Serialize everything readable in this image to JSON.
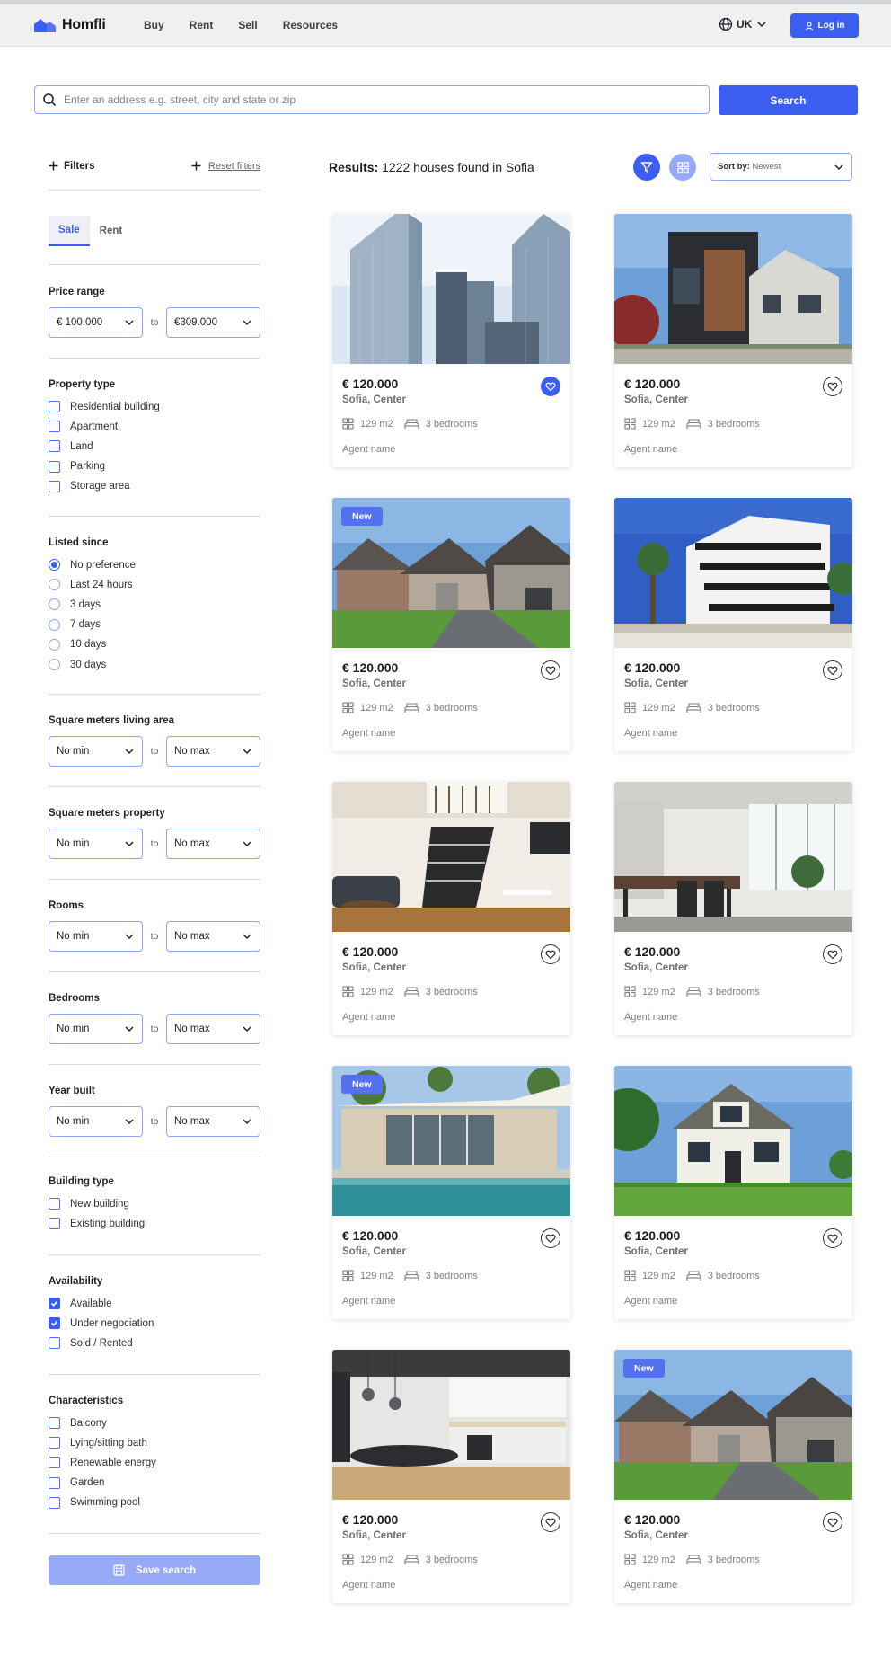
{
  "app": {
    "name": "Homfli"
  },
  "nav": [
    "Buy",
    "Rent",
    "Sell",
    "Resources"
  ],
  "header": {
    "language": "UK",
    "login_label": "Log in"
  },
  "search": {
    "placeholder": "Enter an address e.g. street, city and state or zip",
    "button_label": "Search"
  },
  "sidebar": {
    "filters_label": "Filters",
    "reset_label": "Reset filters",
    "tabs": [
      {
        "label": "Sale",
        "active": true
      },
      {
        "label": "Rent",
        "active": false
      }
    ],
    "price_range": {
      "title": "Price range",
      "from": "€ 100.000",
      "to": "€309.000",
      "to_label": "to"
    },
    "property_type": {
      "title": "Property type",
      "options": [
        "Residential building",
        "Apartment",
        "Land",
        "Parking",
        "Storage area"
      ]
    },
    "listed_since": {
      "title": "Listed since",
      "options": [
        "No preference",
        "Last 24 hours",
        "3 days",
        "7 days",
        "10 days",
        "30 days"
      ],
      "selected": "No preference"
    },
    "ranges": [
      {
        "title": "Square meters living area",
        "min": "No min",
        "max": "No max"
      },
      {
        "title": "Square meters property",
        "min": "No min",
        "max": "No max"
      },
      {
        "title": "Rooms",
        "min": "No min",
        "max": "No max"
      },
      {
        "title": "Bedrooms",
        "min": "No min",
        "max": "No max"
      },
      {
        "title": "Year built",
        "min": "No min",
        "max": "No max"
      }
    ],
    "building_type": {
      "title": "Building type",
      "options": [
        "New building",
        "Existing building"
      ]
    },
    "availability": {
      "title": "Availability",
      "options": [
        {
          "label": "Available",
          "checked": true
        },
        {
          "label": "Under negociation",
          "checked": true
        },
        {
          "label": "Sold / Rented",
          "checked": false
        }
      ]
    },
    "characteristics": {
      "title": "Characteristics",
      "options": [
        "Balcony",
        "Lying/sitting bath",
        "Renewable energy",
        "Garden",
        "Swimming pool"
      ]
    },
    "save_label": "Save search"
  },
  "results": {
    "label": "Results:",
    "text": "1222 houses found in Sofia",
    "sort_label": "Sort by:",
    "sort_value": "Newest"
  },
  "listings": [
    {
      "price": "€ 120.000",
      "location": "Sofia, Center",
      "area": "129 m2",
      "bedrooms": "3 bedrooms",
      "agent": "Agent name",
      "badge": "",
      "favorite": true,
      "image": "skyscrapers"
    },
    {
      "price": "€ 120.000",
      "location": "Sofia, Center",
      "area": "129 m2",
      "bedrooms": "3 bedrooms",
      "agent": "Agent name",
      "badge": "",
      "favorite": false,
      "image": "modern-house"
    },
    {
      "price": "€ 120.000",
      "location": "Sofia, Center",
      "area": "129 m2",
      "bedrooms": "3 bedrooms",
      "agent": "Agent name",
      "badge": "New",
      "favorite": false,
      "image": "suburban-houses"
    },
    {
      "price": "€ 120.000",
      "location": "Sofia, Center",
      "area": "129 m2",
      "bedrooms": "3 bedrooms",
      "agent": "Agent name",
      "badge": "",
      "favorite": false,
      "image": "white-apartment"
    },
    {
      "price": "€ 120.000",
      "location": "Sofia, Center",
      "area": "129 m2",
      "bedrooms": "3 bedrooms",
      "agent": "Agent name",
      "badge": "",
      "favorite": false,
      "image": "living-room"
    },
    {
      "price": "€ 120.000",
      "location": "Sofia, Center",
      "area": "129 m2",
      "bedrooms": "3 bedrooms",
      "agent": "Agent name",
      "badge": "",
      "favorite": false,
      "image": "kitchen-dining"
    },
    {
      "price": "€ 120.000",
      "location": "Sofia, Center",
      "area": "129 m2",
      "bedrooms": "3 bedrooms",
      "agent": "Agent name",
      "badge": "New",
      "favorite": false,
      "image": "pool-house"
    },
    {
      "price": "€ 120.000",
      "location": "Sofia, Center",
      "area": "129 m2",
      "bedrooms": "3 bedrooms",
      "agent": "Agent name",
      "badge": "",
      "favorite": false,
      "image": "cottage"
    },
    {
      "price": "€ 120.000",
      "location": "Sofia, Center",
      "area": "129 m2",
      "bedrooms": "3 bedrooms",
      "agent": "Agent name",
      "badge": "",
      "favorite": false,
      "image": "kitchen"
    },
    {
      "price": "€ 120.000",
      "location": "Sofia, Center",
      "area": "129 m2",
      "bedrooms": "3 bedrooms",
      "agent": "Agent name",
      "badge": "New",
      "favorite": false,
      "image": "suburban-houses"
    }
  ],
  "colors": {
    "accent": "#3b5ef0",
    "accent_light": "#97aaf7",
    "border_accent": "#8ea4f5"
  }
}
